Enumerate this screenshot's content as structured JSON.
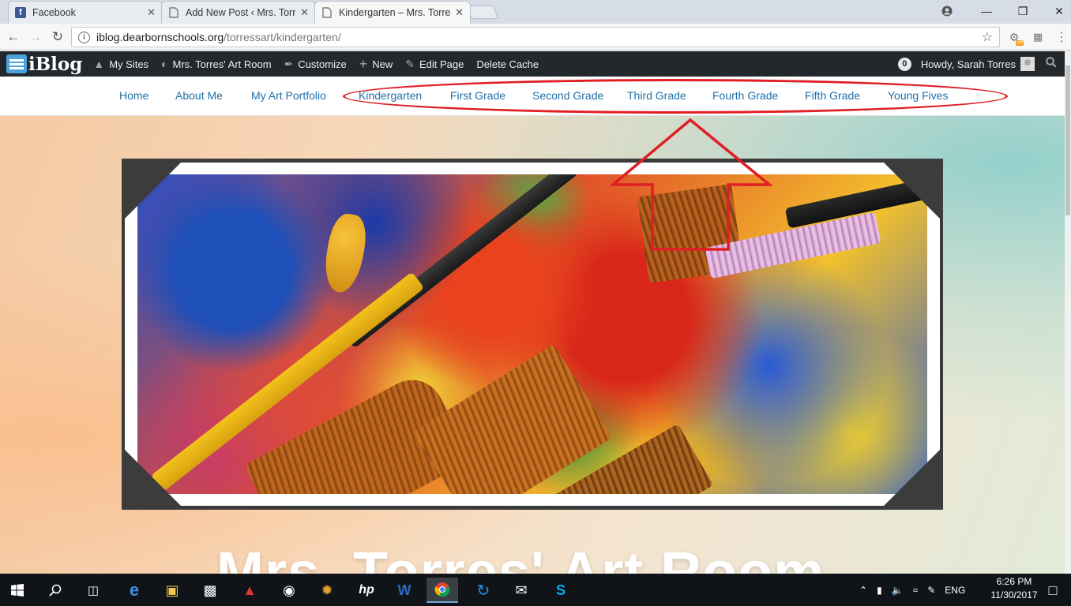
{
  "browser": {
    "tabs": [
      {
        "title": "Facebook",
        "icon": "facebook-icon",
        "active": false
      },
      {
        "title": "Add New Post ‹ Mrs. Torr",
        "icon": "page-icon",
        "active": false
      },
      {
        "title": "Kindergarten – Mrs. Torre",
        "icon": "page-icon",
        "active": true
      }
    ],
    "url_host": "iblog.dearbornschools.org",
    "url_path": "/torressart/kindergarten/",
    "ext_badge": "off"
  },
  "adminbar": {
    "logo_text": "iBlog",
    "items": [
      {
        "label": "My Sites",
        "icon": "sites-icon"
      },
      {
        "label": "Mrs. Torres' Art Room",
        "icon": "dashboard-icon"
      },
      {
        "label": "Customize",
        "icon": "brush-icon"
      },
      {
        "label": "New",
        "icon": "plus-icon"
      },
      {
        "label": "Edit Page",
        "icon": "pencil-icon"
      },
      {
        "label": "Delete Cache",
        "icon": ""
      }
    ],
    "comments_count": "0",
    "howdy": "Howdy, Sarah Torres"
  },
  "nav": {
    "items": [
      "Home",
      "About Me",
      "My Art Portfolio",
      "Kindergarten",
      "First Grade",
      "Second Grade",
      "Third Grade",
      "Fourth Grade",
      "Fifth Grade",
      "Young Fives"
    ]
  },
  "site": {
    "title": "Mrs. Torres' Art Room"
  },
  "annotation_color": "#e01e24",
  "taskbar": {
    "lang": "ENG",
    "time": "6:26 PM",
    "date": "11/30/2017"
  }
}
